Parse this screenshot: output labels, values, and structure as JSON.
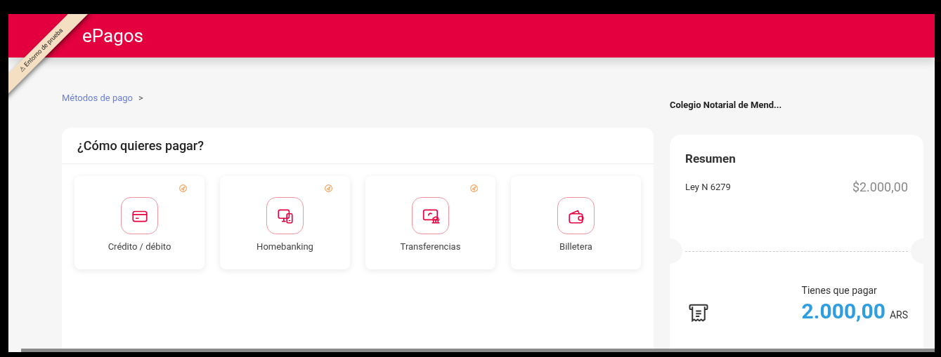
{
  "ribbon": {
    "text": "⚠ Entorno de prueba"
  },
  "header": {
    "logo": "ePagos"
  },
  "breadcrumb": {
    "items": [
      "Métodos de pago"
    ],
    "separator": ">"
  },
  "payment_panel": {
    "title": "¿Cómo quieres pagar?",
    "methods": [
      {
        "kind": "card",
        "label": "Crédito / débito",
        "fast": true
      },
      {
        "kind": "homebanking",
        "label": "Homebanking",
        "fast": true
      },
      {
        "kind": "transfer",
        "label": "Transferencias",
        "fast": true
      },
      {
        "kind": "wallet",
        "label": "Billetera",
        "fast": false
      }
    ]
  },
  "merchant": "Colegio Notarial de Mend...",
  "summary": {
    "title": "Resumen",
    "items": [
      {
        "label": "Ley N 6279",
        "amount": "$2.000,00"
      }
    ],
    "total_label": "Tienes que pagar",
    "total": "2.000,00",
    "currency": "ARS"
  }
}
